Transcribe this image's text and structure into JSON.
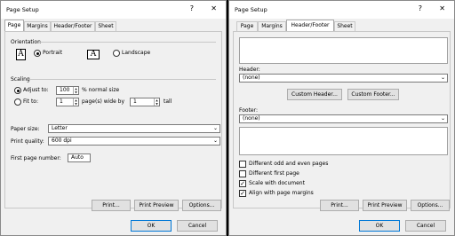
{
  "left": {
    "title": "Page Setup",
    "help": "?",
    "close": "✕",
    "tabs": [
      "Page",
      "Margins",
      "Header/Footer",
      "Sheet"
    ],
    "orientation_label": "Orientation",
    "portrait": "Portrait",
    "landscape": "Landscape",
    "scaling_label": "Scaling",
    "adjust_to": "Adjust to:",
    "adjust_value": "100",
    "normal_size": "% normal size",
    "fit_to": "Fit to:",
    "fit_wide_value": "1",
    "pages_wide_by": "page(s) wide by",
    "fit_tall_value": "1",
    "tall": "tall",
    "paper_size_label": "Paper size:",
    "paper_size_value": "Letter",
    "print_quality_label": "Print quality:",
    "print_quality_value": "600 dpi",
    "first_page_label": "First page number:",
    "first_page_value": "Auto",
    "print_btn": "Print...",
    "print_preview_btn": "Print Preview",
    "options_btn": "Options...",
    "ok_btn": "OK",
    "cancel_btn": "Cancel"
  },
  "right": {
    "title": "Page Setup",
    "help": "?",
    "close": "✕",
    "tabs": [
      "Page",
      "Margins",
      "Header/Footer",
      "Sheet"
    ],
    "header_label": "Header:",
    "header_value": "(none)",
    "custom_header_btn": "Custom Header...",
    "custom_footer_btn": "Custom Footer...",
    "footer_label": "Footer:",
    "footer_value": "(none)",
    "checkboxes": [
      {
        "label": "Different odd and even pages",
        "checked": false
      },
      {
        "label": "Different first page",
        "checked": false
      },
      {
        "label": "Scale with document",
        "checked": true
      },
      {
        "label": "Align with page margins",
        "checked": true
      }
    ],
    "print_btn": "Print...",
    "print_preview_btn": "Print Preview",
    "options_btn": "Options...",
    "ok_btn": "OK",
    "cancel_btn": "Cancel"
  }
}
